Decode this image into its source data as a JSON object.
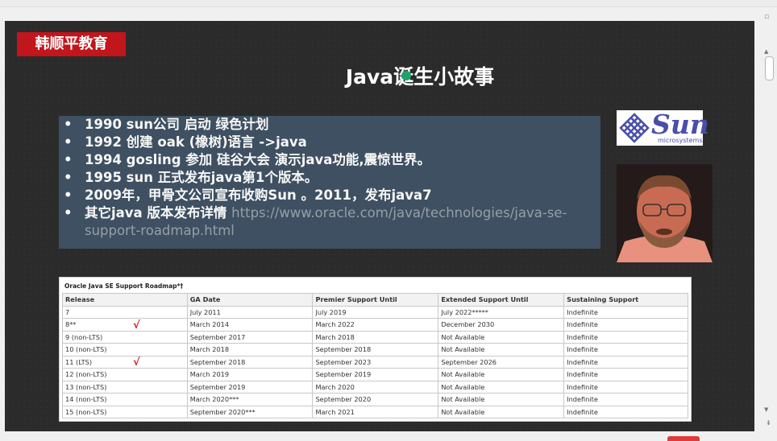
{
  "badge": "韩顺平教育",
  "title": "Java诞生小故事",
  "bullets": [
    "1990 sun公司 启动 绿色计划",
    "1992 创建 oak (橡树)语言 ->java",
    "1994 gosling 参加 硅谷大会 演示java功能,震惊世界。",
    "1995 sun 正式发布java第1个版本。",
    "2009年，甲骨文公司宣布收购Sun 。2011，发布java7"
  ],
  "bullet_last": {
    "label": "其它java 版本发布详情 ",
    "url": "https://www.oracle.com/java/technologies/java-se-support-roadmap.html"
  },
  "logo": {
    "word": "Sun",
    "sub": "microsystems",
    "color": "#4a4fa8"
  },
  "table": {
    "caption": "Oracle Java SE Support Roadmap*†",
    "headers": [
      "Release",
      "GA Date",
      "Premier Support Until",
      "Extended Support Until",
      "Sustaining Support"
    ],
    "rows": [
      [
        "7",
        "July 2011",
        "July 2019",
        "July 2022*****",
        "Indefinite"
      ],
      [
        "8**",
        "March 2014",
        "March 2022",
        "December 2030",
        "Indefinite"
      ],
      [
        "9 (non-LTS)",
        "September 2017",
        "March 2018",
        "Not Available",
        "Indefinite"
      ],
      [
        "10 (non-LTS)",
        "March 2018",
        "September 2018",
        "Not Available",
        "Indefinite"
      ],
      [
        "11 (LTS)",
        "September 2018",
        "September 2023",
        "September 2026",
        "Indefinite"
      ],
      [
        "12 (non-LTS)",
        "March 2019",
        "September 2019",
        "Not Available",
        "Indefinite"
      ],
      [
        "13 (non-LTS)",
        "September 2019",
        "March 2020",
        "Not Available",
        "Indefinite"
      ],
      [
        "14 (non-LTS)",
        "March 2020***",
        "September 2020",
        "Not Available",
        "Indefinite"
      ],
      [
        "15 (non-LTS)",
        "September 2020***",
        "March 2021",
        "Not Available",
        "Indefinite"
      ]
    ]
  },
  "checkmark": "√",
  "scroll": {
    "up": "▲",
    "down": "▼",
    "page": "⇟",
    "corner": "▫"
  }
}
